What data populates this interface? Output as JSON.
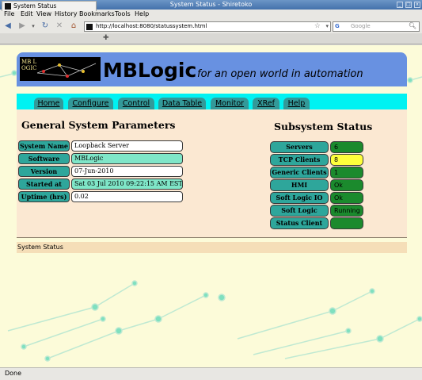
{
  "window": {
    "title": "System Status - Shiretoko"
  },
  "menubar": [
    "File",
    "Edit",
    "View",
    "History",
    "Bookmarks",
    "Tools",
    "Help"
  ],
  "addressbar": {
    "url": "http://localhost:8080/statussystem.html",
    "search_placeholder": "Google",
    "search_engine_icon": "G"
  },
  "tabs": [
    {
      "label": "System Status"
    }
  ],
  "header": {
    "logo_text": "MB LOGIC",
    "brand": "MBLogic",
    "tagline": "for an open world in automation"
  },
  "nav": [
    "Home",
    "Configure",
    "Control",
    "Data Table",
    "Monitor",
    "XRef",
    "Help"
  ],
  "general": {
    "title": "General System Parameters",
    "rows": [
      {
        "label": "System Name",
        "value": "Loopback Server"
      },
      {
        "label": "Software",
        "value": "MBLogic"
      },
      {
        "label": "Version",
        "value": "07-Jun-2010"
      },
      {
        "label": "Started at",
        "value": "Sat 03 Jul 2010 09:22:15 AM EST"
      },
      {
        "label": "Uptime (hrs)",
        "value": "0.02"
      }
    ]
  },
  "subsystem": {
    "title": "Subsystem Status",
    "rows": [
      {
        "label": "Servers",
        "value": "6",
        "color": "#1b8a2d"
      },
      {
        "label": "TCP Clients",
        "value": "8",
        "color": "#ffff3c"
      },
      {
        "label": "Generic Clients",
        "value": "1",
        "color": "#1b8a2d"
      },
      {
        "label": "HMI",
        "value": "Ok",
        "color": "#1b8a2d"
      },
      {
        "label": "Soft Logic IO",
        "value": "Ok",
        "color": "#1b8a2d"
      },
      {
        "label": "Soft Logic",
        "value": "Running",
        "color": "#1b8a2d"
      },
      {
        "label": "Status Client",
        "value": "",
        "color": "#1b8a2d"
      }
    ]
  },
  "footer": {
    "text": "System Status"
  },
  "statusbar": {
    "text": "Done"
  },
  "colors": {
    "header_bg": "#6891e1",
    "nav_strip": "#00f2f2",
    "nav_tab": "#339999",
    "label_bg": "#2ea69b",
    "panel_bg": "#fbe8d2",
    "page_bg": "#fcfbd9"
  }
}
